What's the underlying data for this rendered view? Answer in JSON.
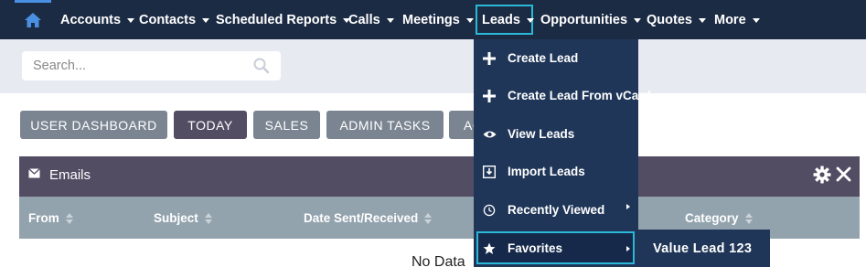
{
  "nav": {
    "items": [
      {
        "label": "Accounts"
      },
      {
        "label": "Contacts"
      },
      {
        "label": "Scheduled Reports"
      },
      {
        "label": "Calls"
      },
      {
        "label": "Meetings"
      },
      {
        "label": "Leads"
      },
      {
        "label": "Opportunities"
      },
      {
        "label": "Quotes"
      },
      {
        "label": "More"
      }
    ]
  },
  "search": {
    "placeholder": "Search..."
  },
  "tabs": [
    {
      "label": "USER DASHBOARD",
      "active": false
    },
    {
      "label": "TODAY",
      "active": true
    },
    {
      "label": "SALES",
      "active": false
    },
    {
      "label": "ADMIN TASKS",
      "active": false
    },
    {
      "label": "AC",
      "active": false
    }
  ],
  "dashlet": {
    "title": "Emails",
    "columns": [
      {
        "label": "From"
      },
      {
        "label": "Subject"
      },
      {
        "label": "Date Sent/Received"
      },
      {
        "label": "Category"
      }
    ],
    "empty_text": "No Data"
  },
  "leads_menu": {
    "items": [
      {
        "label": "Create Lead",
        "icon": "plus-icon"
      },
      {
        "label": "Create Lead From vCard",
        "icon": "plus-icon"
      },
      {
        "label": "View Leads",
        "icon": "eye-icon"
      },
      {
        "label": "Import Leads",
        "icon": "import-icon"
      },
      {
        "label": "Recently Viewed",
        "icon": "history-icon"
      },
      {
        "label": "Favorites",
        "icon": "star-icon"
      }
    ],
    "favorites_submenu": [
      {
        "label": "Value Lead 123"
      }
    ]
  },
  "colors": {
    "navbar": "#1c2b44",
    "accent": "#2ab8d6",
    "tab": "#7a8591",
    "tab_active": "#534d64",
    "dashlet_header": "#534d64",
    "column_header": "#93a3ae",
    "menu": "#1f3658"
  }
}
